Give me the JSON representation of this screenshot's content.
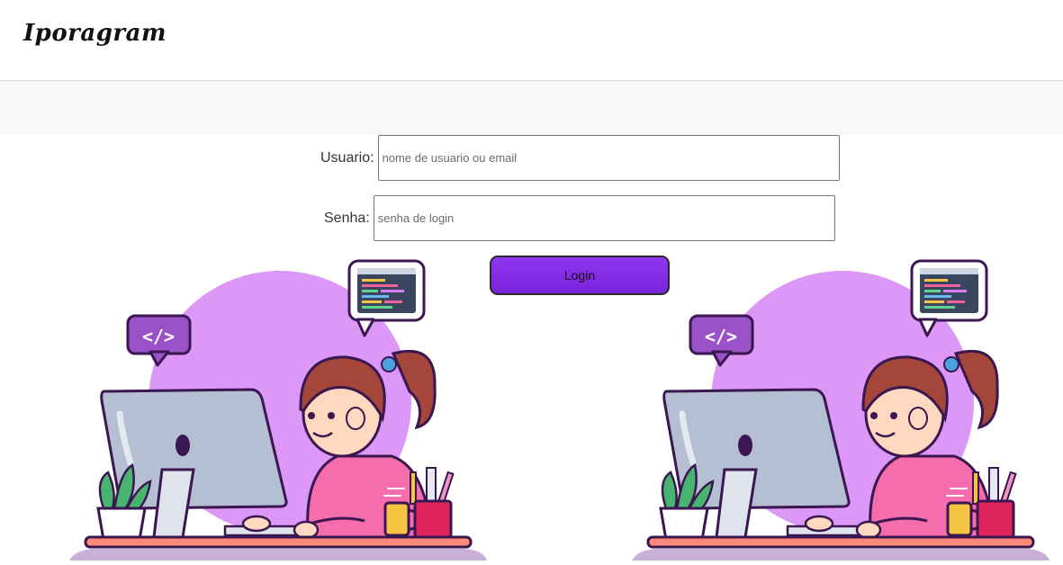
{
  "header": {
    "logo": "Iporagram"
  },
  "form": {
    "user_label": "Usuario:",
    "user_placeholder": "nome de usuario ou email",
    "pass_label": "Senha:",
    "pass_placeholder": "senha de login",
    "login_label": "Login"
  },
  "illustration": {
    "subject": "girl-coding-at-computer",
    "code_bubble_glyph": "</>",
    "colors": {
      "circle": "#dc97f7",
      "hair": "#a4463a",
      "shirt": "#f56dac",
      "monitor": "#b4bfd3",
      "desk": "#ff8a7a",
      "bubble": "#9b52c9"
    }
  },
  "theme": {
    "button": "#8a2be2",
    "band": "#f8f8f8"
  }
}
